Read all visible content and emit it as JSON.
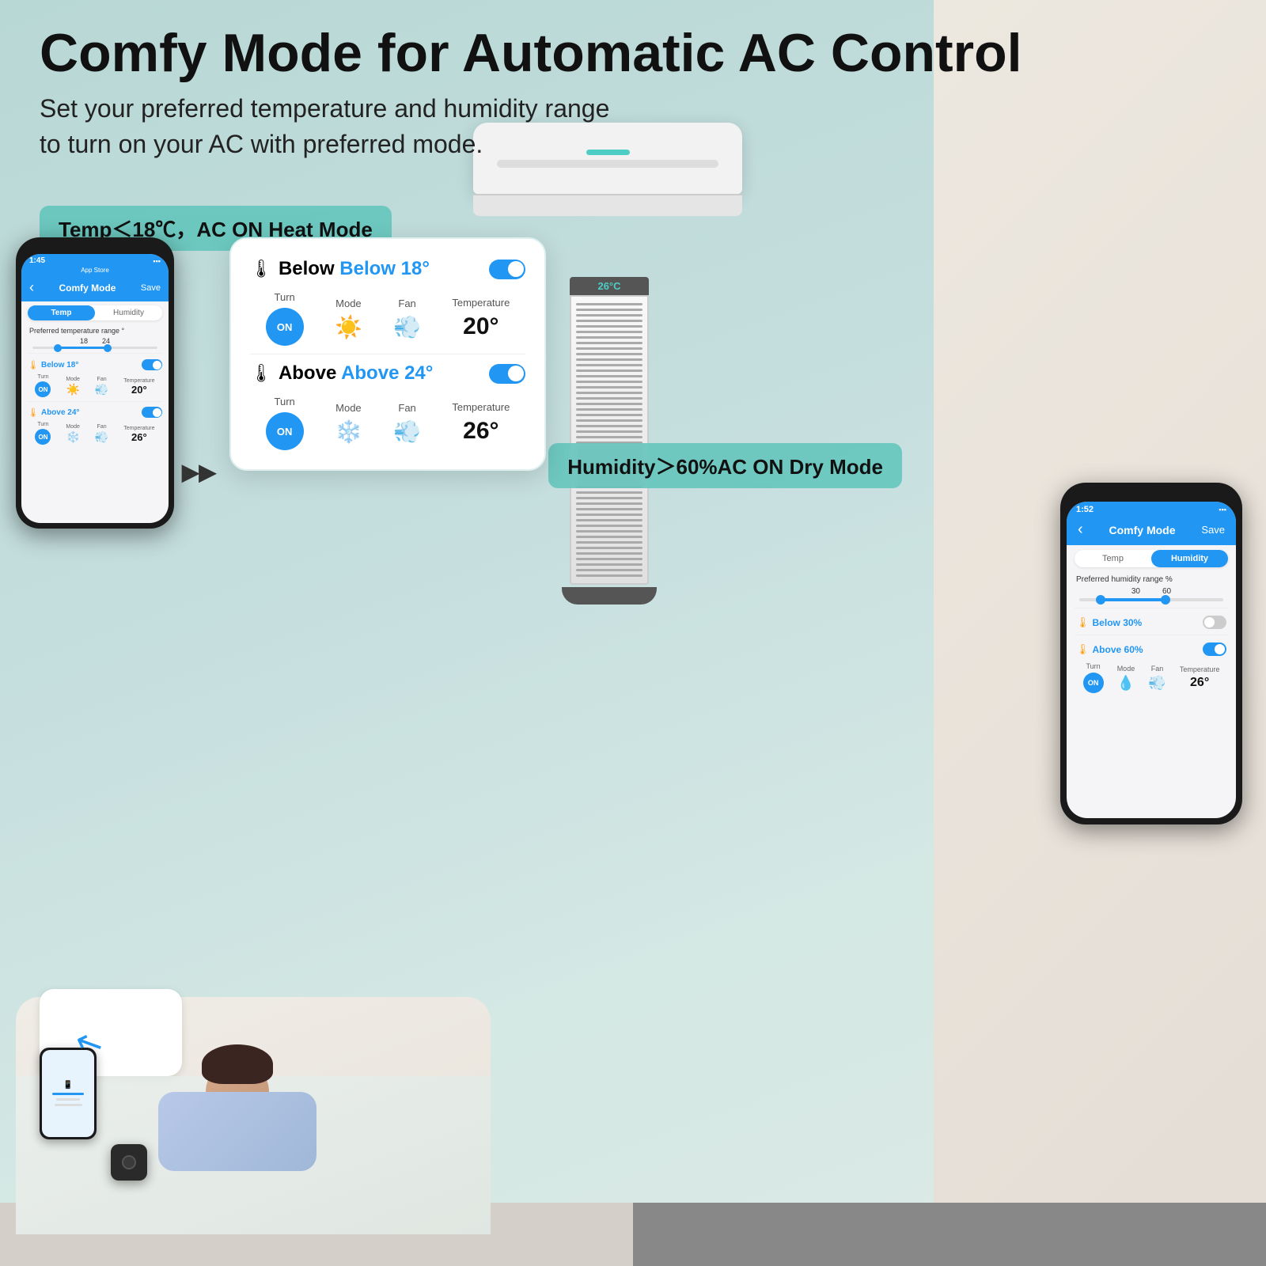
{
  "page": {
    "title": "Comfy Mode for Automatic AC Control",
    "subtitle_line1": "Set your preferred temperature and humidity range",
    "subtitle_line2": "to turn on your AC with preferred mode."
  },
  "conditions": {
    "temp_condition": "Temp＜18℃，AC ON Heat Mode",
    "humidity_condition": "Humidity＞60%AC ON Dry Mode"
  },
  "left_phone": {
    "time": "1:45",
    "app_store": "App Store",
    "header_title": "Comfy Mode",
    "header_save": "Save",
    "tab_temp": "Temp",
    "tab_humidity": "Humidity",
    "range_label": "Preferred temperature range °",
    "slider_min": "18",
    "slider_max": "24",
    "below_label": "Below 18°",
    "above_label": "Above 24°",
    "below_toggle": "on",
    "above_toggle": "on",
    "turn_label": "Turn",
    "mode_label": "Mode",
    "fan_label": "Fan",
    "temp_label": "Temperature",
    "below_turn": "ON",
    "below_temp": "20°",
    "above_turn": "ON",
    "above_temp": "26°"
  },
  "center_card": {
    "below_title": "Below 18°",
    "below_toggle": "on",
    "below_turn_label": "Turn",
    "below_mode_label": "Mode",
    "below_fan_label": "Fan",
    "below_temp_label": "Temperature",
    "below_on": "ON",
    "below_temp": "20°",
    "above_title": "Above 24°",
    "above_toggle": "on",
    "above_turn_label": "Turn",
    "above_mode_label": "Mode",
    "above_fan_label": "Fan",
    "above_temp_label": "Temperature",
    "above_on": "ON",
    "above_temp": "26°"
  },
  "right_phone": {
    "time": "1:52",
    "header_title": "Comfy Mode",
    "header_save": "Save",
    "tab_temp": "Temp",
    "tab_humidity": "Humidity",
    "range_label": "Preferred humidity range %",
    "slider_min": "30",
    "slider_max": "60",
    "below_label": "Below 30%",
    "above_label": "Above 60%",
    "below_toggle": "off",
    "above_toggle": "on",
    "turn_label": "Turn",
    "mode_label": "Mode",
    "fan_label": "Fan",
    "temp_label": "Temperature",
    "above_on": "ON",
    "above_temp": "26°"
  },
  "tower_display": "26°C",
  "icons": {
    "thermometer": "🌡️",
    "sun": "☀️",
    "fan": "💨",
    "snowflake": "❄️",
    "drop": "💧",
    "back": "‹",
    "double_arrow": "▶▶"
  }
}
